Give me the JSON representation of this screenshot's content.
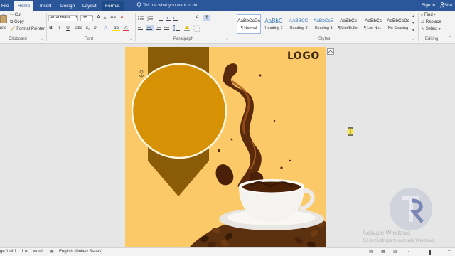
{
  "tabs": [
    {
      "label": "File"
    },
    {
      "label": "Home"
    },
    {
      "label": "Insert"
    },
    {
      "label": "Design"
    },
    {
      "label": "Layout"
    },
    {
      "label": "Format"
    }
  ],
  "tell_me": "Tell me what you want to do...",
  "signin": "Sign in",
  "share": "Sha",
  "clipboard": {
    "paste": "aste",
    "cut": "Cut",
    "copy": "Copy",
    "format_painter": "Format Painter",
    "label": "Clipboard"
  },
  "font": {
    "name": "Arial Black",
    "size": "36",
    "label": "Font",
    "grow": "A",
    "shrink": "A",
    "case": "Aa",
    "clear": "A",
    "bold": "B",
    "italic": "I",
    "underline": "U",
    "strike": "abc",
    "sub": "x₂",
    "sup": "x²",
    "effects": "A",
    "highlight": "ab",
    "color": "A"
  },
  "paragraph": {
    "label": "Paragraph",
    "sort": "A↓",
    "marks": "¶"
  },
  "styles": {
    "label": "Styles",
    "items": [
      {
        "preview": "AaBbCcDc",
        "name": "¶ Normal"
      },
      {
        "preview": "AaBbC",
        "name": "Heading 1"
      },
      {
        "preview": "AABBCC",
        "name": "Heading 2"
      },
      {
        "preview": "AaBbCcE",
        "name": "Heading 3"
      },
      {
        "preview": "AaBbCc",
        "name": "¶ List Bullet"
      },
      {
        "preview": "AaBbCc",
        "name": "¶ List Nu..."
      },
      {
        "preview": "AaBbCcDc",
        "name": "No Spacing"
      }
    ]
  },
  "editing": {
    "label": "Editing",
    "find": "Find",
    "replace": "Replace",
    "select": "Select"
  },
  "page": {
    "logo": "LOGO"
  },
  "status": {
    "page": "ge 1 of 1",
    "words": "1 of 1 word",
    "language": "English (United States)",
    "zoom_minus": "-",
    "zoom_plus": "+"
  },
  "activation": {
    "title": "Activate Windows",
    "subtitle": "Go to Settings to activate Windows."
  },
  "colors": {
    "brand": "#2b579a",
    "page_bg": "#fcc969",
    "ribbon_brown": "#8a5c08",
    "circle": "#d69204"
  }
}
